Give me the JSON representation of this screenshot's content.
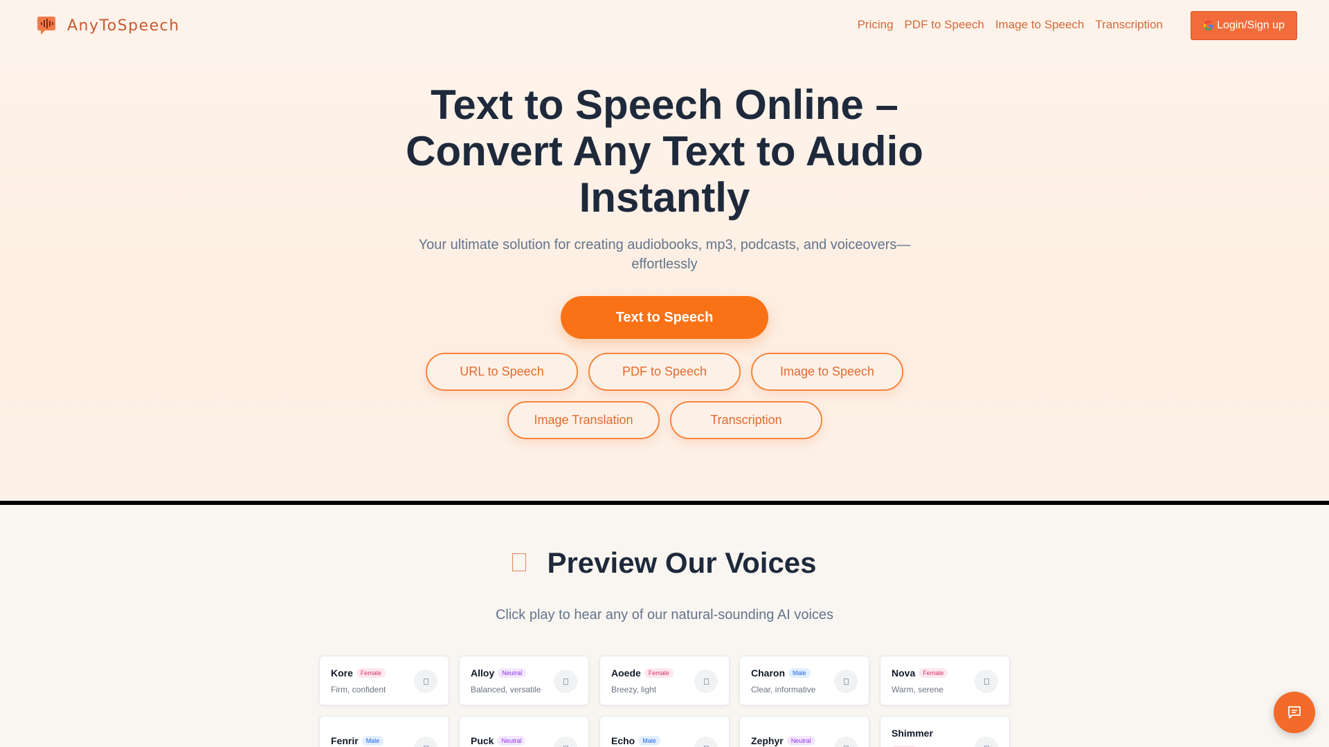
{
  "brand": {
    "name": "AnyToSpeech",
    "logo_icon": "speech-bubble-waveform-icon",
    "accent": "#f97316"
  },
  "nav": {
    "items": [
      "Pricing",
      "PDF to Speech",
      "Image to Speech",
      "Transcription"
    ],
    "login_label": "Login/Sign up",
    "login_icon": "google-icon"
  },
  "hero": {
    "title": "Text to Speech Online – Convert Any Text to Audio Instantly",
    "subtitle": "Your ultimate solution for creating audiobooks, mp3, podcasts, and voiceovers—effortlessly",
    "primary_cta": "Text to Speech",
    "tools": [
      "URL to Speech",
      "PDF to Speech",
      "Image to Speech",
      "Image Translation",
      "Transcription"
    ]
  },
  "voices": {
    "title": "Preview Our Voices",
    "title_icon": "microphone-icon",
    "subtitle": "Click play to hear any of our natural-sounding AI voices",
    "items": [
      {
        "name": "Kore",
        "gender": "Female",
        "desc": "Firm, confident"
      },
      {
        "name": "Alloy",
        "gender": "Neutral",
        "desc": "Balanced, versatile"
      },
      {
        "name": "Aoede",
        "gender": "Female",
        "desc": "Breezy, light"
      },
      {
        "name": "Charon",
        "gender": "Male",
        "desc": "Clear, informative"
      },
      {
        "name": "Nova",
        "gender": "Female",
        "desc": "Warm, serene"
      },
      {
        "name": "Fenrir",
        "gender": "Male",
        "desc": ""
      },
      {
        "name": "Puck",
        "gender": "Neutral",
        "desc": ""
      },
      {
        "name": "Echo",
        "gender": "Male",
        "desc": ""
      },
      {
        "name": "Zephyr",
        "gender": "Neutral",
        "desc": ""
      },
      {
        "name": "Shimmer",
        "gender": "",
        "desc": ""
      }
    ]
  },
  "chat": {
    "icon": "chat-bubble-icon"
  }
}
